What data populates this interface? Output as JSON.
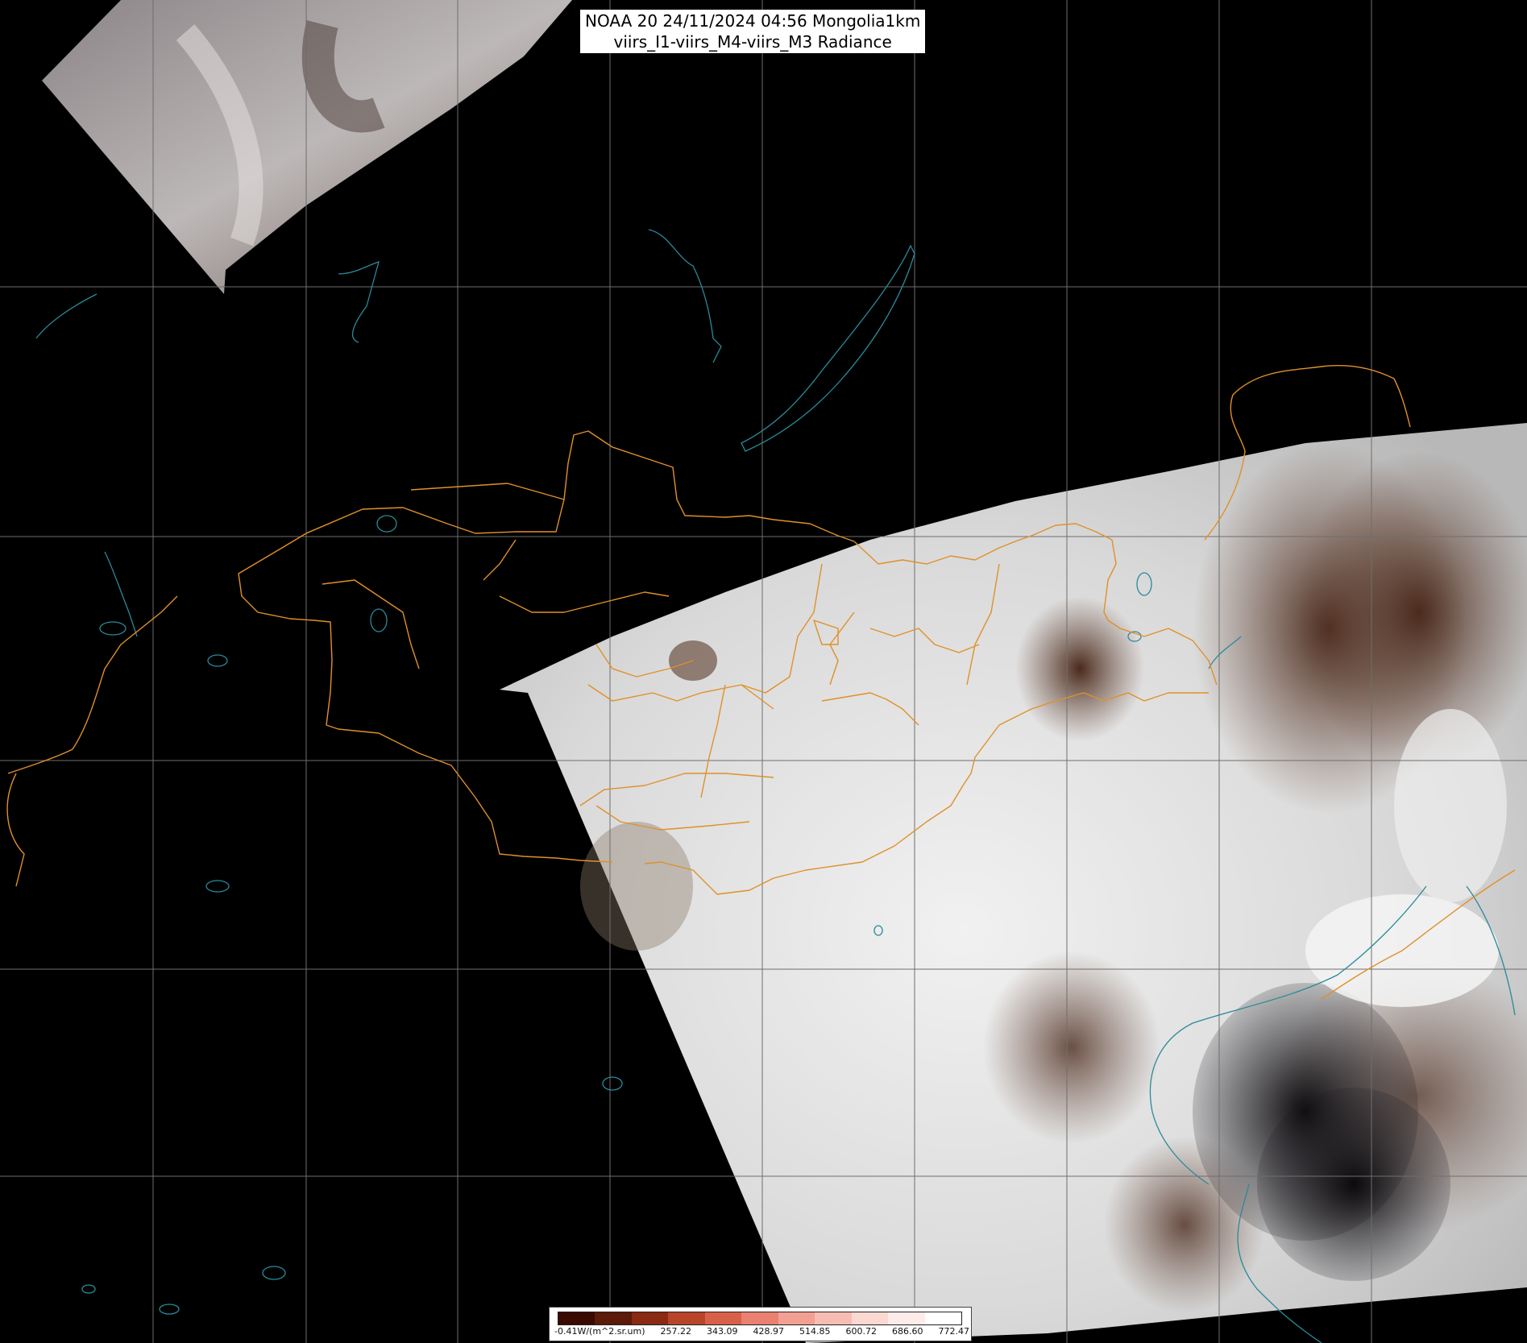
{
  "title": {
    "line1": "NOAA 20 24/11/2024 04:56 Mongolia1km",
    "line2": "viirs_I1-viirs_M4-viirs_M3 Radiance"
  },
  "legend": {
    "labels": [
      "-0.41W/(m^2.sr.um)",
      "257.22",
      "343.09",
      "428.97",
      "514.85",
      "600.72",
      "686.60",
      "772.47"
    ],
    "colors": [
      "#3a0a00",
      "#5c1a08",
      "#8a2a12",
      "#b8442a",
      "#d96048",
      "#e98070",
      "#f3a093",
      "#f7bdb3",
      "#fbd8d2",
      "#fdece9",
      "#ffffff"
    ]
  },
  "colors": {
    "grid": "#6e6e6e",
    "border": "#e0902a",
    "coast": "#2a8a9a",
    "background": "#000000"
  }
}
